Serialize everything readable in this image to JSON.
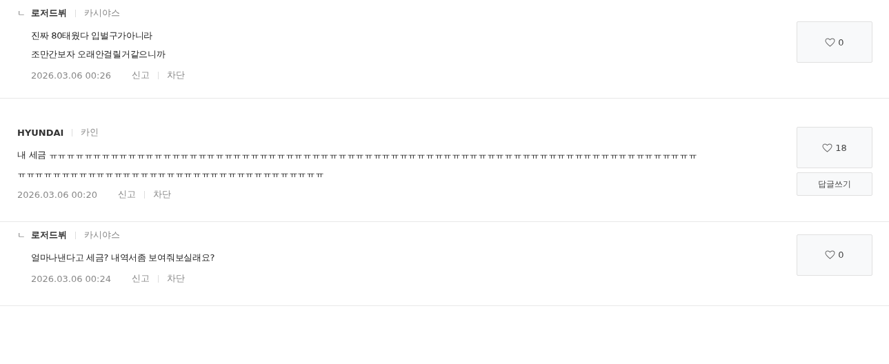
{
  "comments": [
    {
      "kind": "reply",
      "reply_mark": "ㄴ",
      "author": "로저드뷔",
      "car": "카시야스",
      "lines": [
        "진짜 80태웠다 입벌구가아니라",
        "조만간보자 오래안걸릴거같으니까"
      ],
      "date": "2026.03.06 00:26",
      "actions": [
        "신고",
        "차단"
      ],
      "likes": "0"
    },
    {
      "kind": "comment",
      "author": "HYUNDAI",
      "car": "카인",
      "lines": [
        "내 세금 ㅠㅠㅠㅠㅠㅠㅠㅠㅠㅠㅠㅠㅠㅠㅠㅠㅠㅠㅠㅠㅠㅠㅠㅠㅠㅠㅠㅠㅠㅠㅠㅠㅠㅠㅠㅠㅠㅠㅠㅠㅠㅠㅠㅠㅠㅠㅠㅠㅠㅠㅠㅠㅠㅠㅠㅠㅠㅠㅠㅠㅠㅠㅠㅠㅠㅠㅠㅠㅠㅠㅠㅠㅠㅠ",
        "ㅠㅠㅠㅠㅠㅠㅠㅠㅠㅠㅠㅠㅠㅠㅠㅠㅠㅠㅠㅠㅠㅠㅠㅠㅠㅠㅠㅠㅠㅠㅠㅠㅠㅠㅠ"
      ],
      "date": "2026.03.06 00:20",
      "actions": [
        "신고",
        "차단"
      ],
      "likes": "18",
      "reply_button": "답글쓰기"
    },
    {
      "kind": "reply",
      "reply_mark": "ㄴ",
      "author": "로저드뷔",
      "car": "카시야스",
      "lines": [
        "얼마나낸다고 세금? 내역서좀 보여줘보실래요?"
      ],
      "date": "2026.03.06 00:24",
      "actions": [
        "신고",
        "차단"
      ],
      "likes": "0"
    }
  ]
}
